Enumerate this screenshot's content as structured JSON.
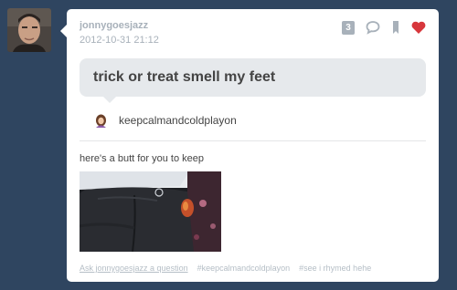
{
  "post": {
    "username": "jonnygoesjazz",
    "timestamp": "2012-10-31 21:12",
    "note_count": "3",
    "question": "trick or treat smell my feet",
    "asker": "keepcalmandcoldplayon",
    "answer": "here's a butt for you to keep"
  },
  "footer": {
    "ask_link": "Ask jonnygoesjazz a question",
    "tags": [
      "#keepcalmandcoldplayon",
      "#see i rhymed hehe"
    ]
  },
  "icons": {
    "notes": "note-count-badge",
    "reply": "speech-bubble-icon",
    "reblog": "bookmark-icon",
    "like": "heart-icon"
  },
  "colors": {
    "background": "#2f4560",
    "card": "#ffffff",
    "question_bubble": "#e6e9ec",
    "like_heart": "#d7373c",
    "muted_text": "#a8b1ba"
  }
}
